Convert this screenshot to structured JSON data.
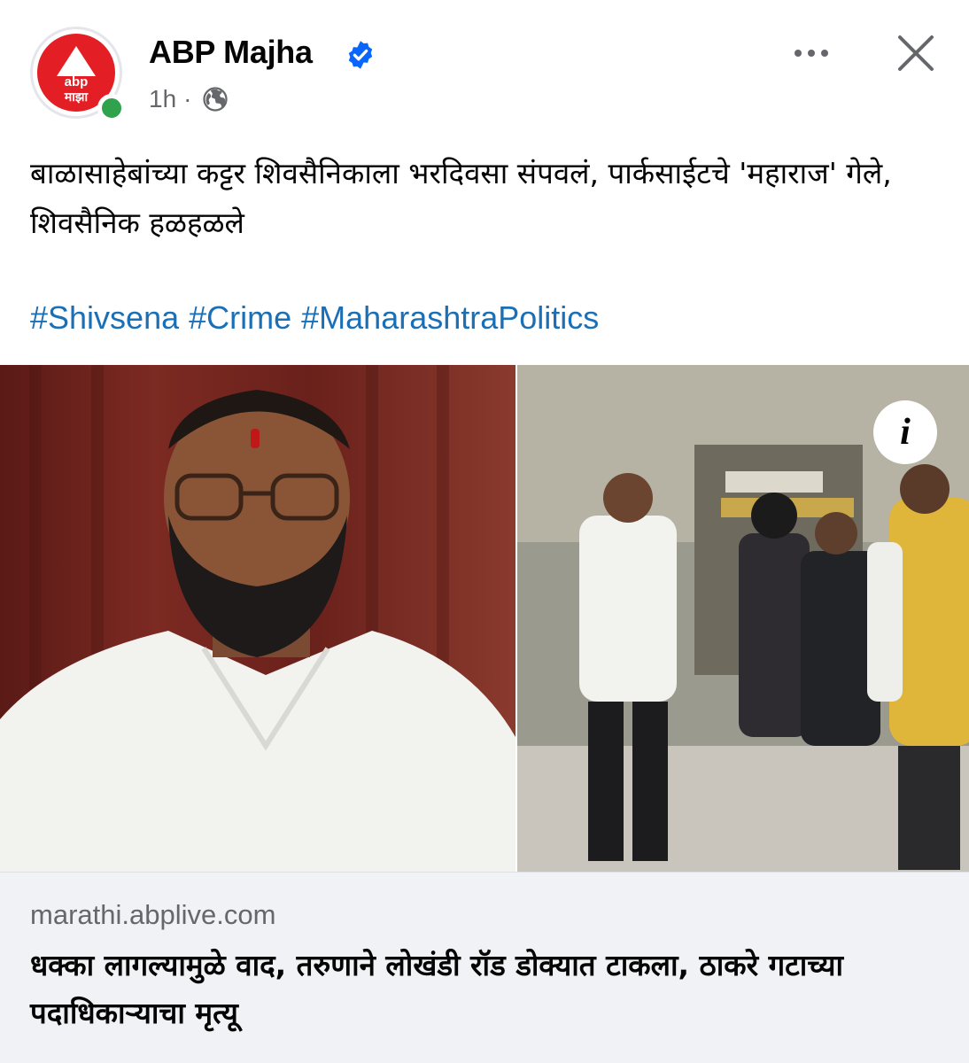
{
  "header": {
    "page_name": "ABP Majha",
    "time": "1h",
    "separator": "·",
    "avatar_line1": "abp",
    "avatar_line2": "माझा",
    "icons": {
      "verified": "verified-badge-icon",
      "audience": "globe-icon",
      "more": "more-options-icon",
      "close": "close-icon",
      "online": "online-status-icon"
    }
  },
  "post": {
    "text": "बाळासाहेबांच्या कट्टर शिवसैनिकाला भरदिवसा संपवलं, पार्कसाईटचे 'महाराज' गेले, शिवसैनिक हळहळले",
    "hashtags": [
      "#Shivsena",
      "#Crime",
      "#MaharashtraPolitics"
    ]
  },
  "info_button": "i",
  "link_preview": {
    "domain": "marathi.abplive.com",
    "headline": "धक्का लागल्यामुळे वाद, तरुणाने लोखंडी रॉड डोक्यात टाकला, ठाकरे गटाच्या पदाधिकाऱ्याचा मृत्यू"
  },
  "colors": {
    "accent_link": "#1b6fb5",
    "verified_blue": "#0866ff",
    "brand_red": "#e31e24",
    "online_green": "#31a24c",
    "secondary_text": "#65676b",
    "link_box_bg": "#f0f2f5"
  }
}
